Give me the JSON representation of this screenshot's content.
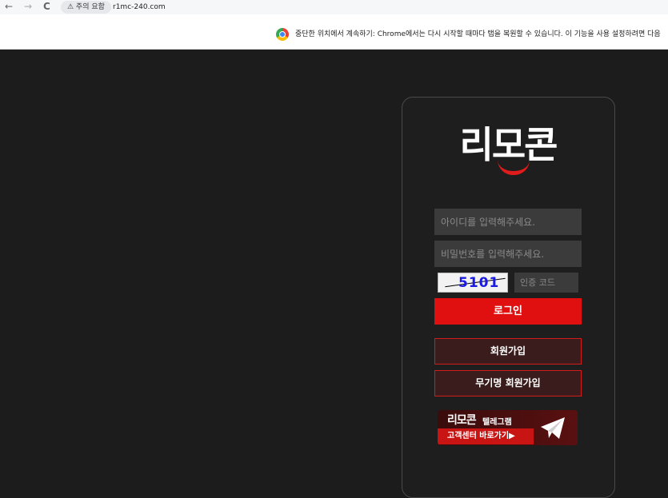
{
  "browser": {
    "back_glyph": "←",
    "forward_glyph": "→",
    "reload_glyph": "C",
    "security_warning": "⚠ 주의 요함",
    "url": "r1mc-240.com"
  },
  "infobar": {
    "message": "중단한 위치에서 계속하기: Chrome에서는 다시 시작할 때마다 탭을 복원할 수 있습니다. 이 기능을 사용 설정하려면 다음"
  },
  "login": {
    "logo_text": "리모콘",
    "username_placeholder": "아이디를 입력해주세요.",
    "password_placeholder": "비밀번호를 입력해주세요.",
    "captcha_value": "5101",
    "code_placeholder": "인증 코드",
    "login_label": "로그인",
    "signup_label": "회원가입",
    "anon_signup_label": "무기명 회원가입"
  },
  "banner": {
    "brand": "리모콘",
    "subtitle": "텔레그램",
    "cta": "고객센터 바로가기▶"
  },
  "colors": {
    "accent": "#e01010",
    "background": "#1c1c1c"
  }
}
